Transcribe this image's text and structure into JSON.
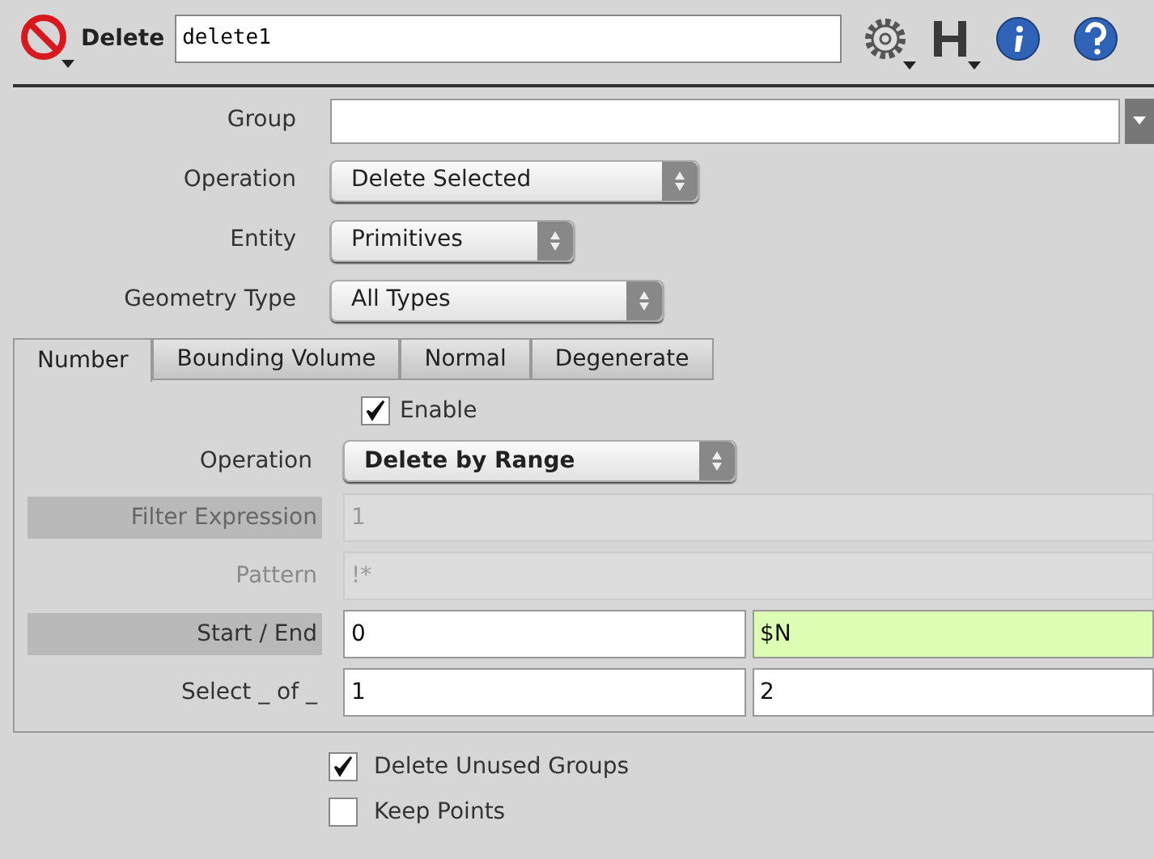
{
  "header": {
    "node_type": "Delete",
    "node_name": "delete1"
  },
  "params": [
    {
      "kind": "group",
      "label": "Group"
    },
    {
      "kind": "menu",
      "label": "Operation",
      "value": "Delete Selected",
      "modified": false
    },
    {
      "kind": "menu",
      "label": "Entity",
      "value": "Primitives",
      "modified": false
    },
    {
      "kind": "menu",
      "label": "Geometry Type",
      "value": "All Types",
      "modified": false
    }
  ],
  "tabs": [
    {
      "label": "Number",
      "selected": true
    },
    {
      "label": "Bounding Volume",
      "selected": false
    },
    {
      "label": "Normal",
      "selected": false
    },
    {
      "label": "Degenerate",
      "selected": false
    }
  ],
  "tab_params": [
    {
      "kind": "toggle",
      "label": "Enable",
      "checked": true
    },
    {
      "kind": "menu",
      "label": "Operation",
      "value": "Delete by Range",
      "modified": true
    },
    {
      "kind": "field",
      "label": "Filter Expression",
      "disabled": true,
      "highlighted": true,
      "values": [
        {
          "text": "1",
          "expression": false
        }
      ]
    },
    {
      "kind": "field",
      "label": "Pattern",
      "disabled": true,
      "highlighted": false,
      "values": [
        {
          "text": "!*",
          "expression": false
        }
      ]
    },
    {
      "kind": "field",
      "label": "Start / End",
      "disabled": false,
      "highlighted": true,
      "values": [
        {
          "text": "0",
          "expression": false
        },
        {
          "text": "$N",
          "expression": true
        }
      ]
    },
    {
      "kind": "field",
      "label": "Select _ of _",
      "disabled": false,
      "highlighted": false,
      "values": [
        {
          "text": "1",
          "expression": false
        },
        {
          "text": "2",
          "expression": false
        }
      ]
    }
  ],
  "options": [
    {
      "label": "Delete Unused Groups",
      "checked": true
    },
    {
      "label": "Keep Points",
      "checked": false
    }
  ]
}
